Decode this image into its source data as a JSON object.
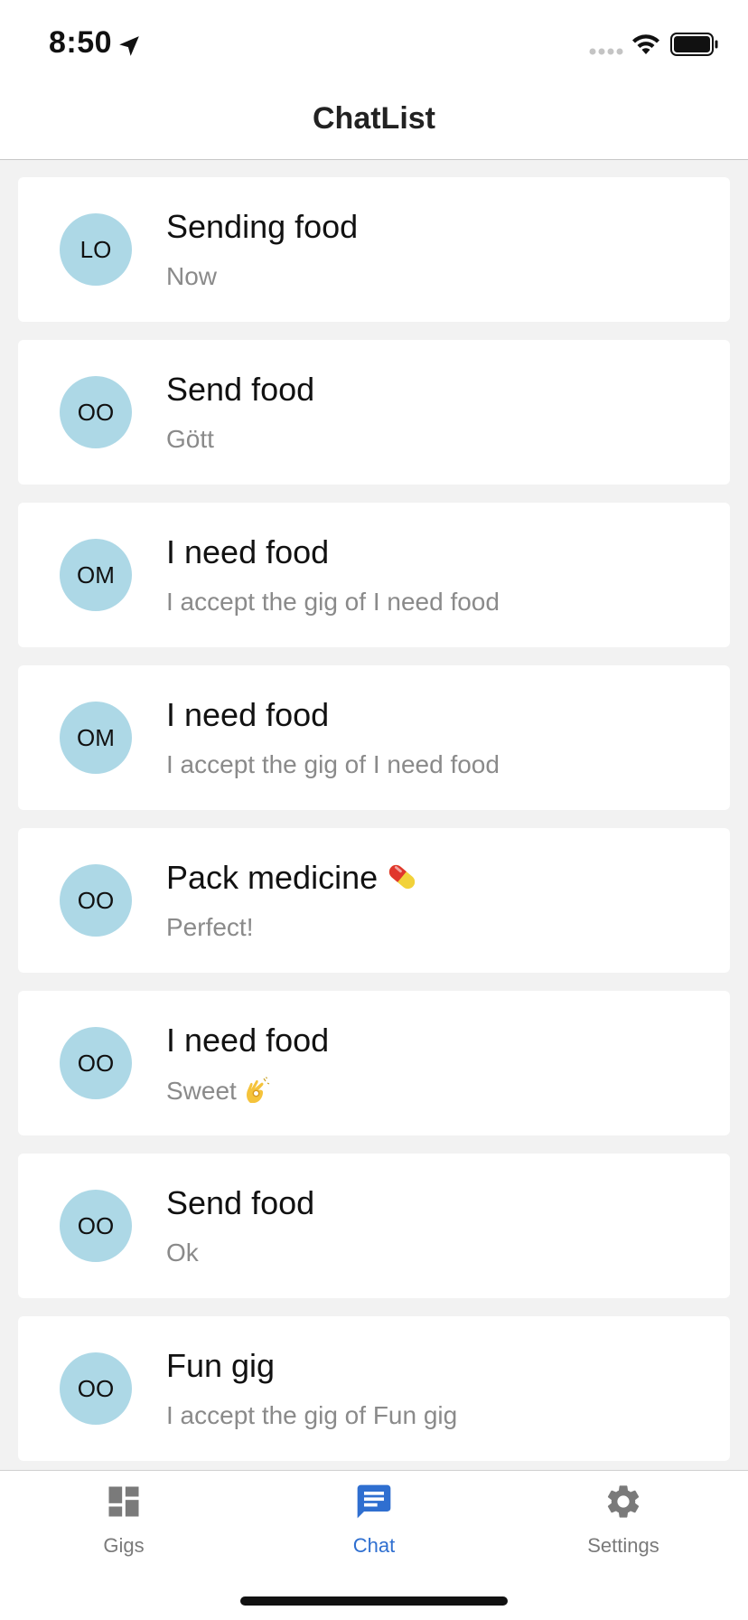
{
  "status_bar": {
    "time": "8:50"
  },
  "header": {
    "title": "ChatList"
  },
  "chats": [
    {
      "initials": "LO",
      "title": "Sending food",
      "preview": "Now"
    },
    {
      "initials": "OO",
      "title": "Send food",
      "preview": "Gött"
    },
    {
      "initials": "OM",
      "title": "I need food",
      "preview": "I accept the gig of I need food"
    },
    {
      "initials": "OM",
      "title": "I need food",
      "preview": "I accept the gig of I need food"
    },
    {
      "initials": "OO",
      "title": "Pack medicine",
      "title_icon": "pill-emoji-icon",
      "preview": "Perfect!"
    },
    {
      "initials": "OO",
      "title": "I need food",
      "preview": "Sweet",
      "preview_icon": "ok-hand-emoji-icon"
    },
    {
      "initials": "OO",
      "title": "Send food",
      "preview": "Ok"
    },
    {
      "initials": "OO",
      "title": "Fun gig",
      "preview": "I accept the gig of Fun gig"
    }
  ],
  "tabs": [
    {
      "label": "Gigs",
      "icon": "dashboard-icon",
      "active": false
    },
    {
      "label": "Chat",
      "icon": "chat-icon",
      "active": true
    },
    {
      "label": "Settings",
      "icon": "gear-icon",
      "active": false
    }
  ],
  "colors": {
    "avatar": "#add8e6",
    "active_tab": "#2f6fd0",
    "inactive_tab": "#7a7a7a",
    "background": "#f2f2f2"
  }
}
